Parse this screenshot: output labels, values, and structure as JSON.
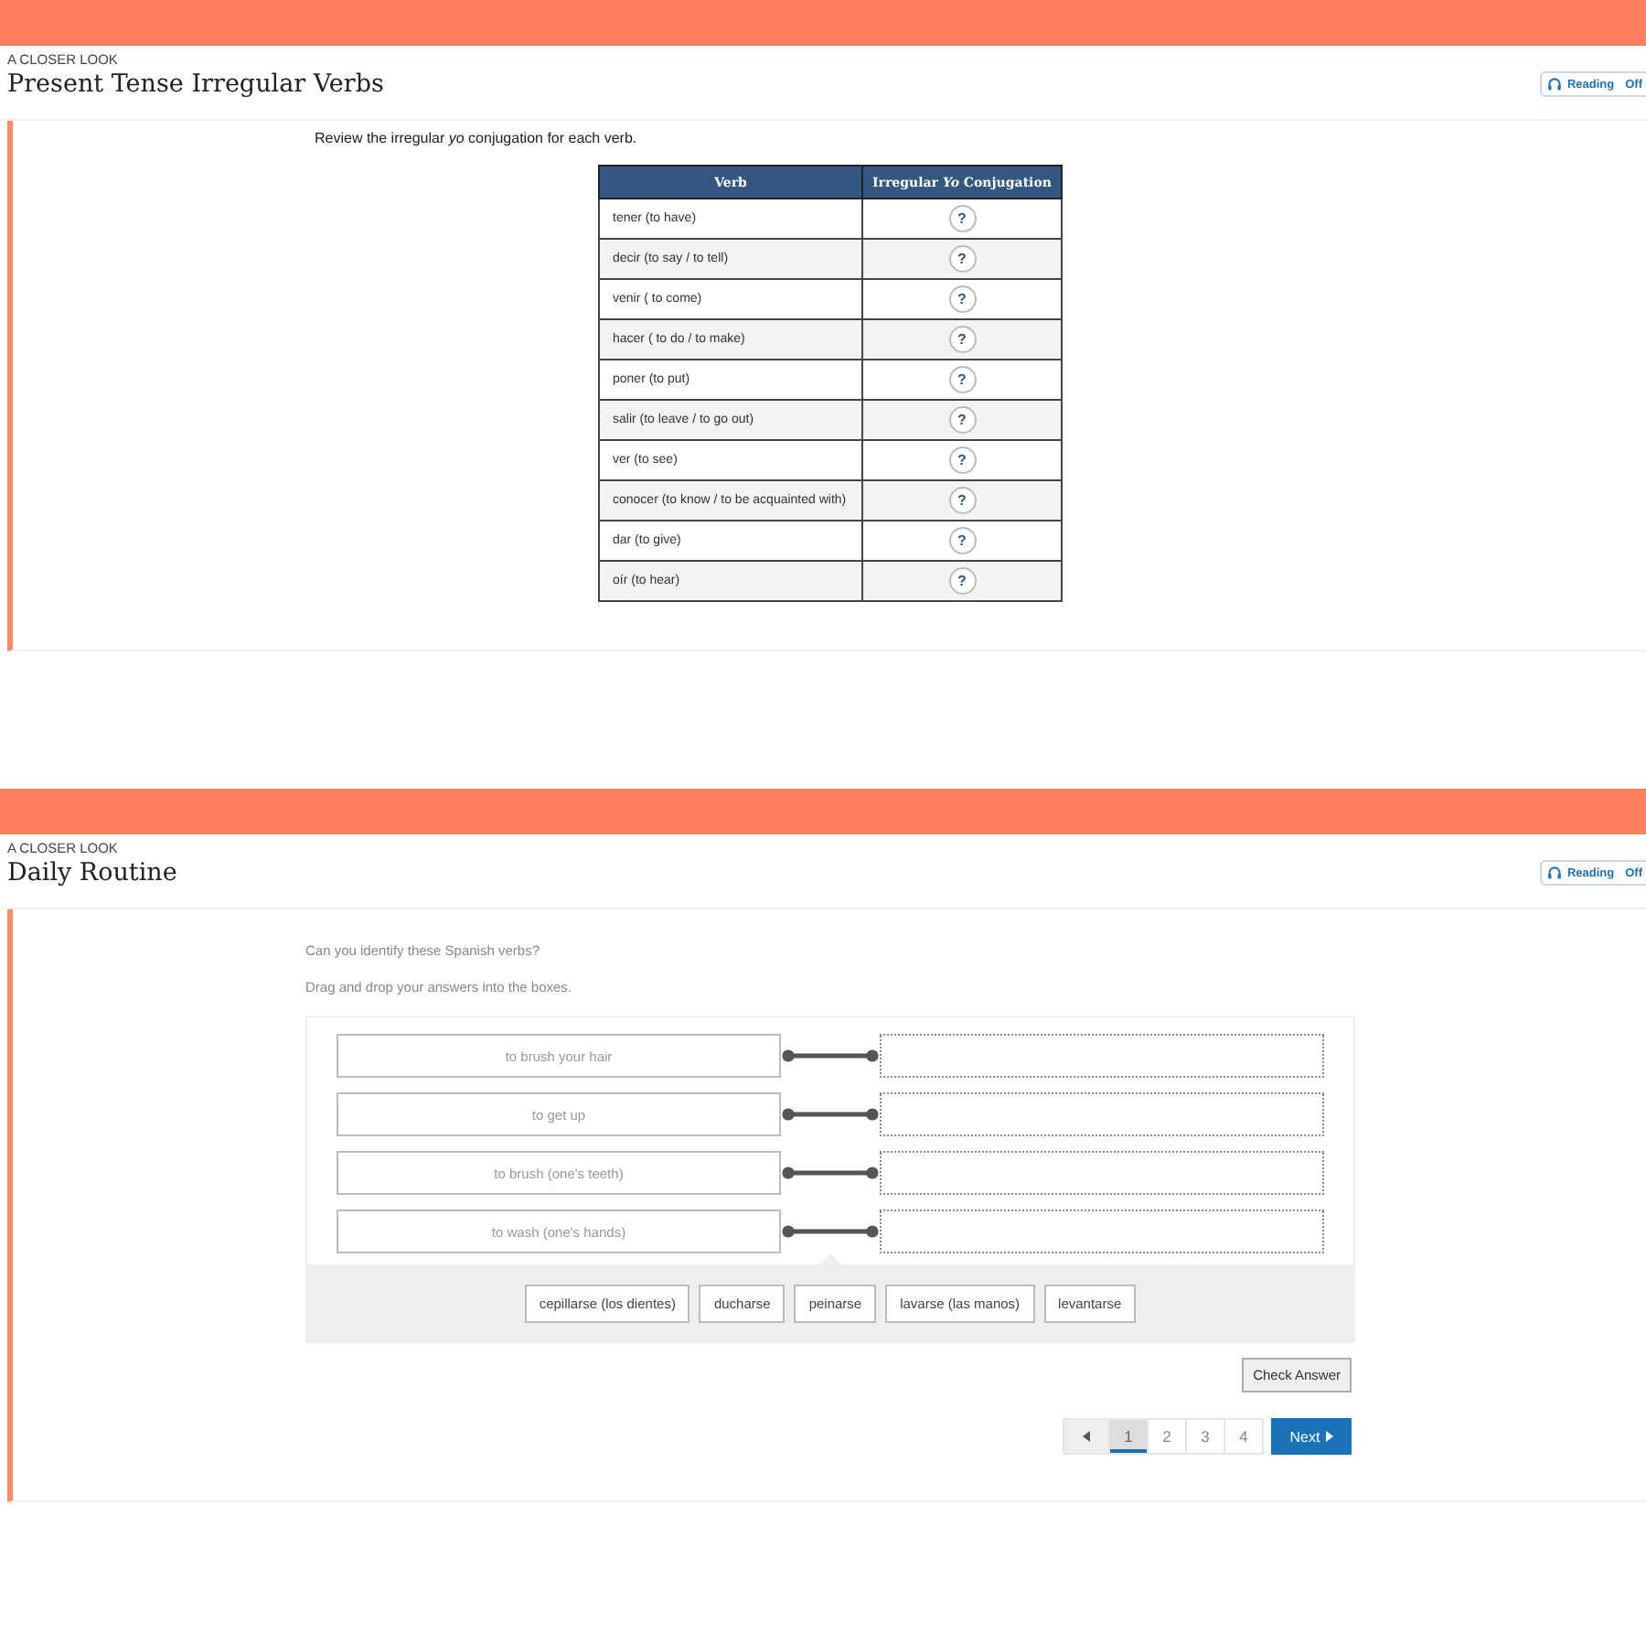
{
  "sections": [
    {
      "kind": "table",
      "eyebrow": "A CLOSER LOOK",
      "title": "Present Tense Irregular Verbs",
      "reading": {
        "label": "Reading",
        "state": "Off"
      },
      "instruction": "Review the irregular *yo* conjugation for each verb.",
      "table": {
        "columns": [
          "Verb",
          "Irregular *Yo* Conjugation"
        ],
        "rows": [
          {
            "verb": "tener (to have)",
            "answer": "?"
          },
          {
            "verb": "decir (to say / to tell)",
            "answer": "?"
          },
          {
            "verb": "venir ( to come)",
            "answer": "?"
          },
          {
            "verb": "hacer ( to do / to make)",
            "answer": "?"
          },
          {
            "verb": "poner (to put)",
            "answer": "?"
          },
          {
            "verb": "salir (to leave / to go out)",
            "answer": "?"
          },
          {
            "verb": "ver (to see)",
            "answer": "?"
          },
          {
            "verb": "conocer (to know / to be acquainted with)",
            "answer": "?"
          },
          {
            "verb": "dar (to give)",
            "answer": "?"
          },
          {
            "verb": "oír (to hear)",
            "answer": "?"
          }
        ]
      }
    },
    {
      "kind": "dragdrop",
      "eyebrow": "A CLOSER LOOK",
      "title": "Daily Routine",
      "reading": {
        "label": "Reading",
        "state": "Off"
      },
      "prompts": [
        "Can you identify these Spanish verbs?",
        "Drag and drop your answers into the boxes."
      ],
      "pairs": [
        {
          "prompt": "to brush your hair"
        },
        {
          "prompt": "to get up"
        },
        {
          "prompt": "to brush (one's teeth)"
        },
        {
          "prompt": "to wash (one's hands)"
        }
      ],
      "answers": [
        "cepillarse (los dientes)",
        "ducharse",
        "peinarse",
        "lavarse (las manos)",
        "levantarse"
      ],
      "check_button": "Check Answer",
      "pages": [
        {
          "label": "1",
          "selected": true
        },
        {
          "label": "2",
          "selected": false
        },
        {
          "label": "3",
          "selected": false
        },
        {
          "label": "4",
          "selected": false
        }
      ],
      "next_button": "Next"
    }
  ]
}
